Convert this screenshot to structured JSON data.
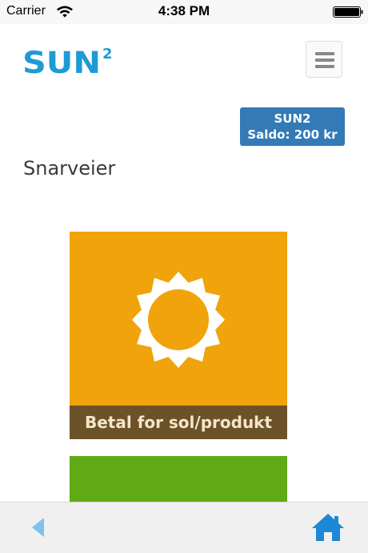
{
  "status_bar": {
    "carrier": "Carrier",
    "time": "4:38 PM"
  },
  "header": {
    "logo_text": "SUN²",
    "menu_icon": "hamburger-icon"
  },
  "balance": {
    "line1": "SUN2",
    "line2": "Saldo: 200 kr"
  },
  "page": {
    "title": "Snarveier"
  },
  "shortcuts": [
    {
      "label": "Betal for sol/produkt",
      "icon": "sun-icon",
      "color": "#f0a30a"
    },
    {
      "label": "",
      "icon": "",
      "color": "#60a917"
    }
  ],
  "bottom_nav": {
    "back_icon": "back-arrow-icon",
    "home_icon": "home-icon"
  },
  "colors": {
    "brand_blue": "#1e9ad6",
    "badge_blue": "#337ab7",
    "tile_orange": "#f0a30a",
    "caption_brown": "#6b5229",
    "tile_green": "#60a917",
    "nav_blue": "#1e88d6"
  }
}
